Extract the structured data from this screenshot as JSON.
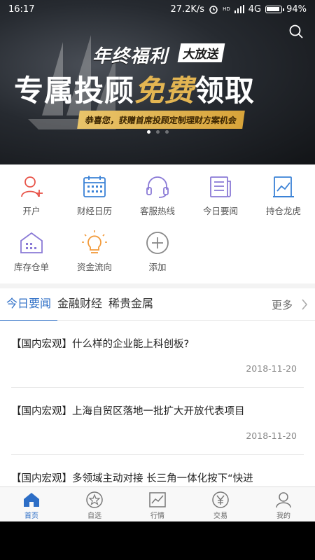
{
  "status_bar": {
    "time": "16:17",
    "network_speed": "27.2K/s",
    "signal_label": "HD",
    "network_type": "4G",
    "battery": "94%",
    "battery_level": 0.94
  },
  "banner": {
    "line1": "年终福利",
    "tag": "大放送",
    "line2_a": "专属投顾",
    "line2_b": "免费",
    "line2_c": "领取",
    "strip": "恭喜您，获赠首席投顾定制理财方案机会",
    "slide_count": 3,
    "active_slide": 1
  },
  "quick_menu": [
    {
      "label": "开户",
      "icon": "add-user-icon"
    },
    {
      "label": "财经日历",
      "icon": "calendar-icon"
    },
    {
      "label": "客服热线",
      "icon": "headset-icon"
    },
    {
      "label": "今日要闻",
      "icon": "news-icon"
    },
    {
      "label": "持仓龙虎",
      "icon": "chart-doc-icon"
    },
    {
      "label": "库存仓单",
      "icon": "warehouse-icon"
    },
    {
      "label": "资金流向",
      "icon": "lightbulb-icon"
    },
    {
      "label": "添加",
      "icon": "add-circle-icon"
    }
  ],
  "tabs": {
    "items": [
      "今日要闻",
      "金融财经",
      "稀贵金属"
    ],
    "active": 0,
    "more": "更多"
  },
  "news": [
    {
      "title": "【国内宏观】什么样的企业能上科创板?",
      "date": "2018-11-20"
    },
    {
      "title": "【国内宏观】上海自贸区落地一批扩大开放代表项目",
      "date": "2018-11-20"
    },
    {
      "title": "【国内宏观】多领域主动对接 长三角一体化按下“快进",
      "date": ""
    }
  ],
  "bottom_nav": [
    {
      "label": "首页",
      "icon": "home-icon",
      "active": true
    },
    {
      "label": "自选",
      "icon": "star-icon",
      "active": false
    },
    {
      "label": "行情",
      "icon": "market-chart-icon",
      "active": false
    },
    {
      "label": "交易",
      "icon": "yen-icon",
      "active": false
    },
    {
      "label": "我的",
      "icon": "profile-icon",
      "active": false
    }
  ],
  "colors": {
    "accent": "#2d6ec6",
    "red_icon": "#e8554a",
    "blue_icon": "#3b82d6",
    "purple_icon": "#8a7ad6",
    "orange_icon": "#f29a3a",
    "gold": "#e3b552"
  }
}
